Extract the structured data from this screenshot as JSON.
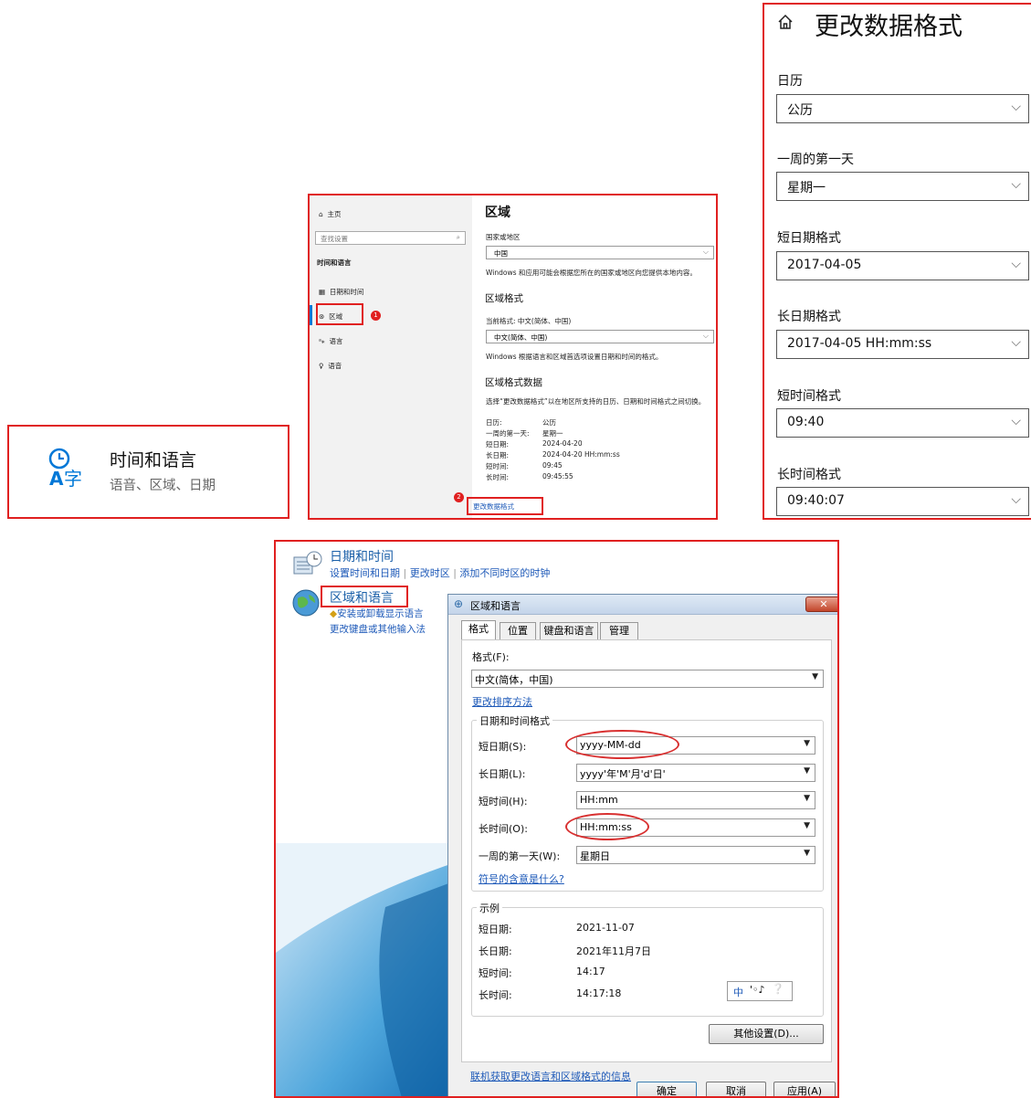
{
  "panel_settings_tile": {
    "title": "时间和语言",
    "subtitle": "语音、区域、日期"
  },
  "panel_region": {
    "sidebar": {
      "home": "主页",
      "search_placeholder": "查找设置",
      "section": "时间和语言",
      "items": [
        "日期和时间",
        "区域",
        "语言",
        "语音"
      ]
    },
    "badge1": "1",
    "badge2": "2",
    "title": "区域",
    "country_label": "国家或地区",
    "country_value": "中国",
    "country_note": "Windows 和应用可能会根据您所在的国家或地区向您提供本地内容。",
    "format_heading": "区域格式",
    "current_format": "当前格式: 中文(简体、中国)",
    "format_value": "中文(简体、中国)",
    "format_note": "Windows 根据语言和区域首选项设置日期和时间的格式。",
    "data_heading": "区域格式数据",
    "data_note": "选择“更改数据格式”以在地区所支持的日历、日期和时间格式之间切换。",
    "rows": [
      {
        "k": "日历:",
        "v": "公历"
      },
      {
        "k": "一周的第一天:",
        "v": "星期一"
      },
      {
        "k": "短日期:",
        "v": "2024-04-20"
      },
      {
        "k": "长日期:",
        "v": "2024-04-20 HH:mm:ss"
      },
      {
        "k": "短时间:",
        "v": "09:45"
      },
      {
        "k": "长时间:",
        "v": "09:45:55"
      }
    ],
    "change_link": "更改数据格式"
  },
  "panel_change_format": {
    "title": "更改数据格式",
    "fields": [
      {
        "label": "日历",
        "value": "公历"
      },
      {
        "label": "一周的第一天",
        "value": "星期一"
      },
      {
        "label": "短日期格式",
        "value": "2017-04-05"
      },
      {
        "label": "长日期格式",
        "value": "2017-04-05 HH:mm:ss"
      },
      {
        "label": "短时间格式",
        "value": "09:40"
      },
      {
        "label": "长时间格式",
        "value": "09:40:07"
      }
    ]
  },
  "panel_control_panel": {
    "date_time_title": "日期和时间",
    "date_time_links": [
      "设置时间和日期",
      "更改时区",
      "添加不同时区的时钟"
    ],
    "region_title": "区域和语言",
    "region_links": [
      "安装或卸载显示语言",
      "更改键盘或其他输入法"
    ],
    "dialog": {
      "title": "区域和语言",
      "tabs": [
        "格式",
        "位置",
        "键盘和语言",
        "管理"
      ],
      "format_label": "格式(F):",
      "format_value": "中文(简体，中国)",
      "sort_link": "更改排序方法",
      "group_title": "日期和时间格式",
      "rows": [
        {
          "label": "短日期(S):",
          "value": "yyyy-MM-dd"
        },
        {
          "label": "长日期(L):",
          "value": "yyyy'年'M'月'd'日'"
        },
        {
          "label": "短时间(H):",
          "value": "HH:mm"
        },
        {
          "label": "长时间(O):",
          "value": "HH:mm:ss"
        },
        {
          "label": "一周的第一天(W):",
          "value": "星期日"
        }
      ],
      "symbol_link": "符号的含意是什么?",
      "example_title": "示例",
      "examples": [
        {
          "k": "短日期:",
          "v": "2021-11-07"
        },
        {
          "k": "长日期:",
          "v": "2021年11月7日"
        },
        {
          "k": "短时间:",
          "v": "14:17"
        },
        {
          "k": "长时间:",
          "v": "14:17:18"
        }
      ],
      "ime_label": "中",
      "more_button": "其他设置(D)...",
      "online_link": "联机获取更改语言和区域格式的信息",
      "ok": "确定",
      "cancel": "取消",
      "apply": "应用(A)"
    }
  },
  "colors": {
    "accent_red": "#e02020",
    "link_blue": "#1d59b8",
    "win_blue": "#0078d7"
  }
}
